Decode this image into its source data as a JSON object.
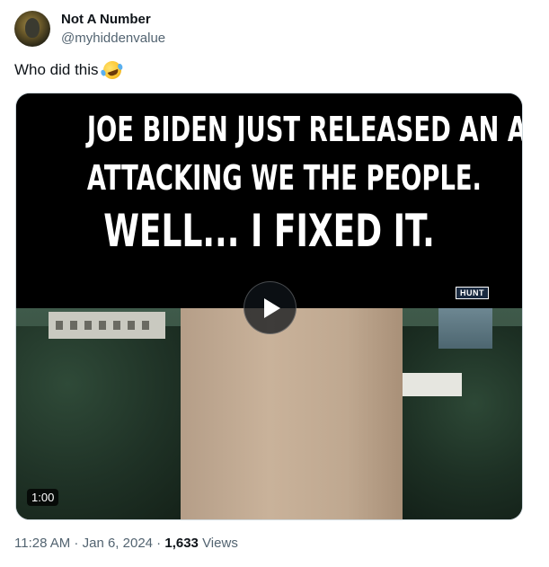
{
  "author": {
    "display_name": "Not A Number",
    "handle": "@myhiddenvalue"
  },
  "tweet": {
    "text": "Who did this",
    "emoji": "rolling-on-floor-laughing-emoji"
  },
  "media": {
    "caption_line1": "JOE BIDEN JUST RELEASED AN AD",
    "caption_line2": "ATTACKING WE THE PEOPLE.",
    "caption_line3": "WELL... I FIXED IT.",
    "watermark": "HUNT",
    "duration": "1:00"
  },
  "meta": {
    "time": "11:28 AM",
    "separator1": " · ",
    "date": "Jan 6, 2024",
    "separator2": " · ",
    "views_count": "1,633",
    "views_label": " Views"
  },
  "colors": {
    "text_primary": "#0f1419",
    "text_secondary": "#536471",
    "border": "#cfd9de"
  }
}
